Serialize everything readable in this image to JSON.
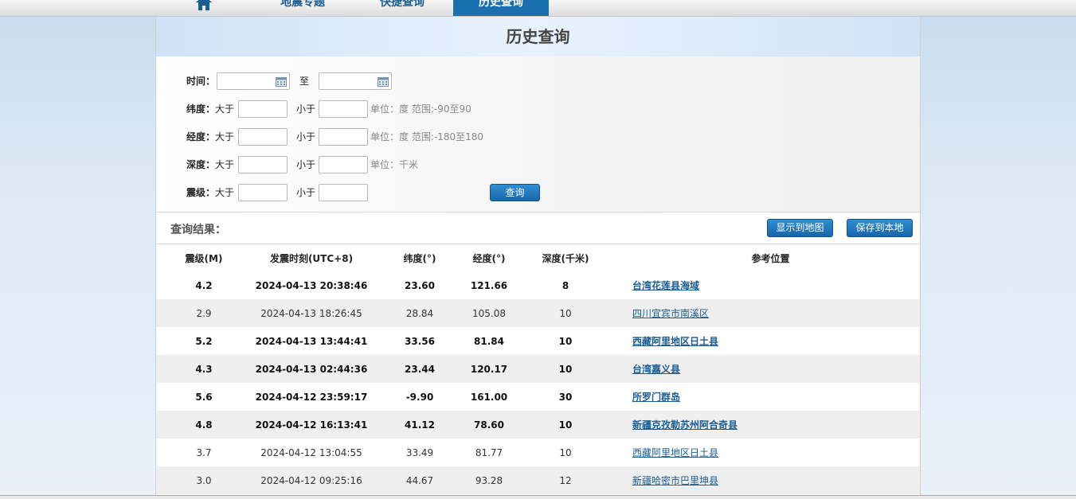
{
  "nav": {
    "items": [
      "地震专题",
      "快捷查询",
      "历史查询"
    ]
  },
  "panel": {
    "title": "历史查询"
  },
  "form": {
    "time": {
      "label": "时间：",
      "to": "至"
    },
    "lat": {
      "label": "纬度：",
      "gt": "大于",
      "lt": "小于",
      "unit": "单位：度 范围:-90至90"
    },
    "lon": {
      "label": "经度：",
      "gt": "大于",
      "lt": "小于",
      "unit": "单位：度 范围:-180至180"
    },
    "depth": {
      "label": "深度：",
      "gt": "大于",
      "lt": "小于",
      "unit": "单位：千米"
    },
    "mag": {
      "label": "震级：",
      "gt": "大于",
      "lt": "小于"
    },
    "query_label": "查询"
  },
  "results": {
    "title": "查询结果：",
    "show_map": "显示到地图",
    "save_local": "保存到本地",
    "headers": [
      "震级(M)",
      "发震时刻(UTC+8)",
      "纬度(°)",
      "经度(°)",
      "深度(千米)",
      "参考位置"
    ],
    "rows": [
      {
        "m": "4.2",
        "t": "2024-04-13 20:38:46",
        "lat": "23.60",
        "lon": "121.66",
        "d": "8",
        "loc": "台湾花莲县海域",
        "bold": true
      },
      {
        "m": "2.9",
        "t": "2024-04-13 18:26:45",
        "lat": "28.84",
        "lon": "105.08",
        "d": "10",
        "loc": "四川宜宾市南溪区",
        "bold": false
      },
      {
        "m": "5.2",
        "t": "2024-04-13 13:44:41",
        "lat": "33.56",
        "lon": "81.84",
        "d": "10",
        "loc": "西藏阿里地区日土县",
        "bold": true
      },
      {
        "m": "4.3",
        "t": "2024-04-13 02:44:36",
        "lat": "23.44",
        "lon": "120.17",
        "d": "10",
        "loc": "台湾嘉义县",
        "bold": true
      },
      {
        "m": "5.6",
        "t": "2024-04-12 23:59:17",
        "lat": "-9.90",
        "lon": "161.00",
        "d": "30",
        "loc": "所罗门群岛",
        "bold": true
      },
      {
        "m": "4.8",
        "t": "2024-04-12 16:13:41",
        "lat": "41.12",
        "lon": "78.60",
        "d": "10",
        "loc": "新疆克孜勒苏州阿合奇县",
        "bold": true
      },
      {
        "m": "3.7",
        "t": "2024-04-12 13:04:55",
        "lat": "33.49",
        "lon": "81.77",
        "d": "10",
        "loc": "西藏阿里地区日土县",
        "bold": false
      },
      {
        "m": "3.0",
        "t": "2024-04-12 09:25:16",
        "lat": "44.67",
        "lon": "93.28",
        "d": "12",
        "loc": "新疆哈密市巴里坤县",
        "bold": false
      }
    ]
  }
}
